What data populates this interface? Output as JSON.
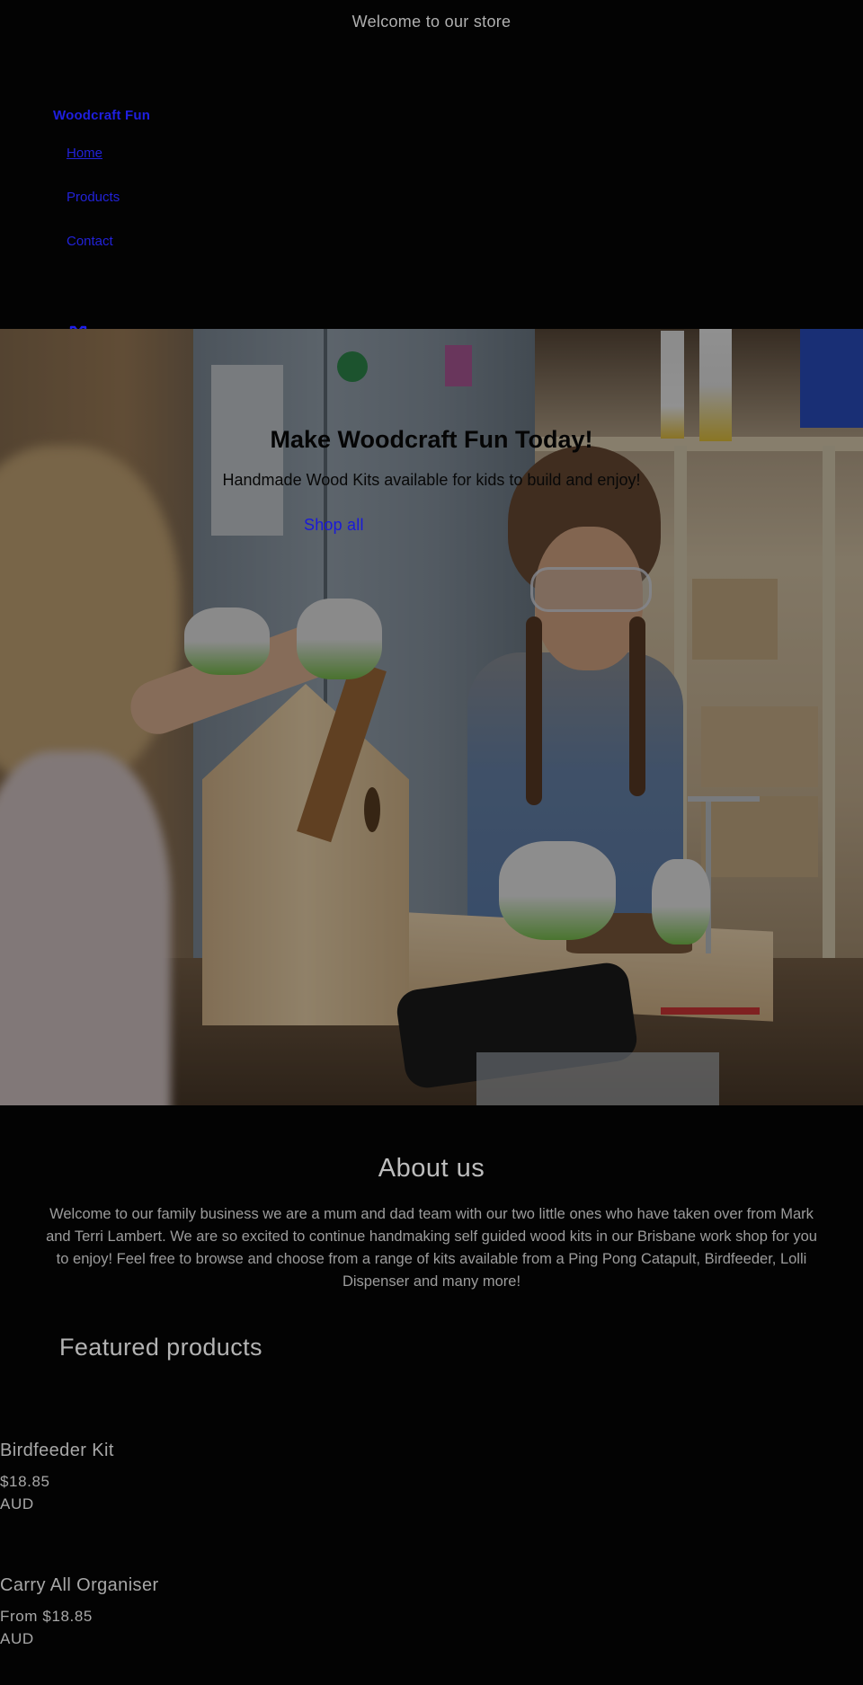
{
  "announcement": {
    "text": "Welcome to our store"
  },
  "header": {
    "logo": "Woodcraft Fun",
    "nav": [
      {
        "label": "Home",
        "active": true
      },
      {
        "label": "Products",
        "active": false
      },
      {
        "label": "Contact",
        "active": false
      }
    ],
    "cart_icon": "shopping-bag-icon"
  },
  "hero": {
    "title": "Make Woodcraft Fun Today!",
    "subtitle": "Handmade Wood Kits available for kids to build and enjoy!",
    "button_label": "Shop all",
    "image_alt": "Two girls building a wooden birdhouse in a workshop"
  },
  "about": {
    "title": "About us",
    "text": "Welcome to our family business we are a mum and dad team with our two little ones who have taken over from Mark and Terri Lambert. We are so excited to continue handmaking self guided wood kits in our Brisbane work shop for you to enjoy! Feel free to browse and choose from a range of kits available from a Ping Pong Catapult, Birdfeeder, Lolli Dispenser and many more!"
  },
  "featured": {
    "title": "Featured products",
    "products": [
      {
        "name": "Birdfeeder Kit",
        "price": "$18.85",
        "currency": "AUD"
      },
      {
        "name": "Carry All Organiser",
        "price": "From $18.85",
        "currency": "AUD"
      }
    ]
  },
  "colors": {
    "background": "#030303",
    "link": "#1f1fe0",
    "text": "#a4a4a4"
  }
}
